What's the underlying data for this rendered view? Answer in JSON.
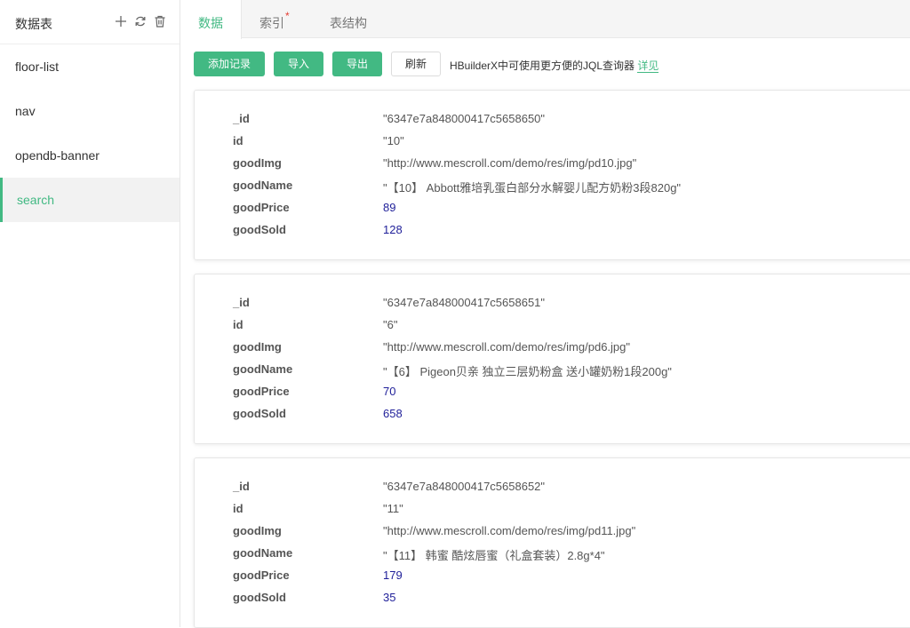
{
  "sidebar": {
    "title": "数据表",
    "items": [
      {
        "label": "floor-list"
      },
      {
        "label": "nav"
      },
      {
        "label": "opendb-banner"
      },
      {
        "label": "search"
      }
    ]
  },
  "tabs": [
    {
      "label": "数据"
    },
    {
      "label": "索引",
      "marker": "*"
    },
    {
      "label": "表结构"
    }
  ],
  "toolbar": {
    "add_label": "添加记录",
    "import_label": "导入",
    "export_label": "导出",
    "refresh_label": "刷新",
    "tip_text": "HBuilderX中可使用更方便的JQL查询器",
    "tip_link": "详见"
  },
  "colors": {
    "accent": "#42b983",
    "number": "#1f1f99",
    "required": "#e43d33"
  },
  "records": [
    {
      "_id": "\"6347e7a848000417c5658650\"",
      "id": "\"10\"",
      "goodImg": "\"http://www.mescroll.com/demo/res/img/pd10.jpg\"",
      "goodName": "\"【10】 Abbott雅培乳蛋白部分水解婴儿配方奶粉3段820g\"",
      "goodPrice": "89",
      "goodSold": "128"
    },
    {
      "_id": "\"6347e7a848000417c5658651\"",
      "id": "\"6\"",
      "goodImg": "\"http://www.mescroll.com/demo/res/img/pd6.jpg\"",
      "goodName": "\"【6】 Pigeon贝亲 独立三层奶粉盒 送小罐奶粉1段200g\"",
      "goodPrice": "70",
      "goodSold": "658"
    },
    {
      "_id": "\"6347e7a848000417c5658652\"",
      "id": "\"11\"",
      "goodImg": "\"http://www.mescroll.com/demo/res/img/pd11.jpg\"",
      "goodName": "\"【11】 韩蜜 酷炫唇蜜（礼盒套装）2.8g*4\"",
      "goodPrice": "179",
      "goodSold": "35"
    }
  ]
}
